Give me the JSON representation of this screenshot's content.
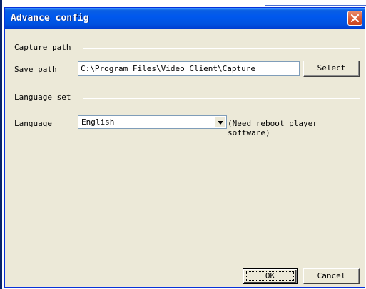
{
  "window": {
    "title": "Advance config",
    "close_icon": "close-icon"
  },
  "capture": {
    "group_label": "Capture path",
    "save_path_label": "Save path",
    "save_path_value": "C:\\Program Files\\Video Client\\Capture",
    "select_label": "Select"
  },
  "language": {
    "group_label": "Language set",
    "field_label": "Language",
    "selected_value": "English",
    "note": "(Need reboot player software)"
  },
  "footer": {
    "ok_label": "OK",
    "cancel_label": "Cancel"
  },
  "colors": {
    "titlebar": "#0058ee",
    "dialog_bg": "#ece9d8",
    "close_button": "#d95a33"
  }
}
